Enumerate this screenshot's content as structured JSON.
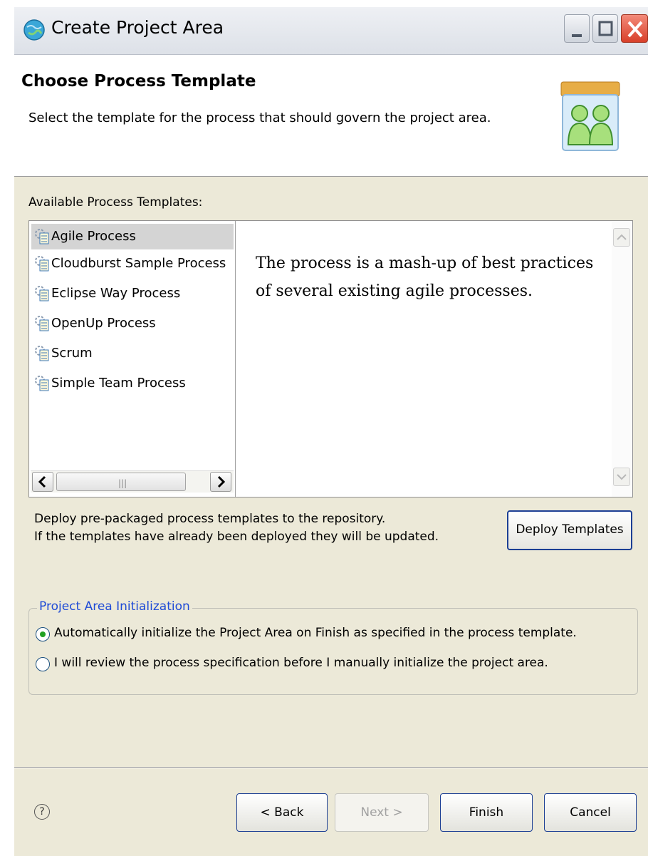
{
  "window": {
    "title": "Create Project Area"
  },
  "header": {
    "title": "Choose Process Template",
    "description": "Select the template for the process that should govern the project area."
  },
  "templates": {
    "label": "Available Process Templates:",
    "items": [
      {
        "label": "Agile Process",
        "selected": true
      },
      {
        "label": "Cloudburst Sample Process",
        "selected": false
      },
      {
        "label": "Eclipse Way Process",
        "selected": false
      },
      {
        "label": "OpenUp Process",
        "selected": false
      },
      {
        "label": "Scrum",
        "selected": false
      },
      {
        "label": "Simple Team Process",
        "selected": false
      }
    ],
    "description": "The process is a mash-up of best practices of several existing agile processes."
  },
  "deploy": {
    "line1": "Deploy pre-packaged process templates to the repository.",
    "line2": "If the templates have already been deployed they will be updated.",
    "button": "Deploy Templates"
  },
  "initialization": {
    "legend": "Project Area Initialization",
    "option_auto": "Automatically initialize the Project Area on Finish as specified in the process template.",
    "option_manual": "I will review the process specification before I manually initialize the project area.",
    "selected": "auto"
  },
  "footer": {
    "help": "?",
    "back": "< Back",
    "next": "Next >",
    "finish": "Finish",
    "cancel": "Cancel"
  },
  "colors": {
    "accent": "#1f4bd6",
    "selection": "#d4d4d4",
    "dialog_bg": "#ece9d8"
  }
}
